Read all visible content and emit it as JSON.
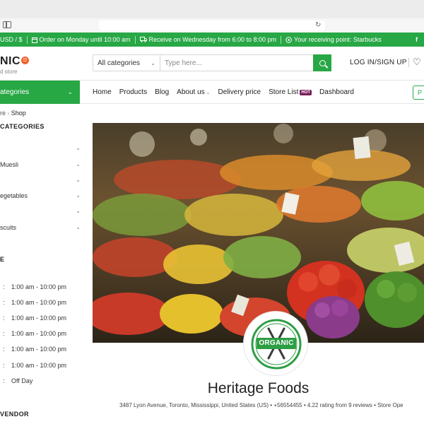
{
  "topbar": {
    "currency": "USD / $",
    "order": "Order on Monday until 10:00 am",
    "receive": "Receive on Wednesday from 6:00 to 8:00 pm",
    "point": "Your receiving point: Starbucks"
  },
  "header": {
    "logo_text": "NIC",
    "logo_badge": "D",
    "logo_tagline": "d store",
    "search": {
      "category": "All categories",
      "placeholder": "Type here..."
    },
    "login": "LOG IN/SIGN UP"
  },
  "nav": {
    "all_categories": "ategories",
    "links": [
      "Home",
      "Products",
      "Blog",
      "About us",
      "Delivery price",
      "Store List",
      "Dashboard"
    ],
    "hot_badge": "HOT",
    "cta": "P"
  },
  "sidebar": {
    "breadcrumb_home": "re",
    "breadcrumb_current": "Shop",
    "categories_title": "CATEGORIES",
    "categories": [
      "",
      "Muesli",
      "",
      "egetables",
      "",
      "scuits",
      ""
    ],
    "hours_title": "E",
    "hours": [
      "1:00 am - 10:00 pm",
      "1:00 am - 10:00 pm",
      "1:00 am - 10:00 pm",
      "1:00 am - 10:00 pm",
      "1:00 am - 10:00 pm",
      "1:00 am - 10:00 pm",
      "Off Day"
    ],
    "vendor_title": "VENDOR"
  },
  "store": {
    "badge_text": "ORGANIC",
    "name": "Heritage Foods",
    "info": "3487 Lyon Avenue, Toronto, Mississippi, United States (US) • +56554455 • 4.22 rating from 9 reviews • Store Ope"
  },
  "colors": {
    "brand_green": "#28a745",
    "badge_orange": "#f0642c",
    "hot_badge": "#7a1f5c"
  },
  "icons": {
    "topbar_items": [
      "currency-icon",
      "calendar-icon",
      "truck-icon",
      "location-icon",
      "facebook-icon"
    ],
    "header": [
      "search-icon",
      "heart-icon",
      "sidebar-toggle-icon",
      "reload-icon"
    ]
  }
}
